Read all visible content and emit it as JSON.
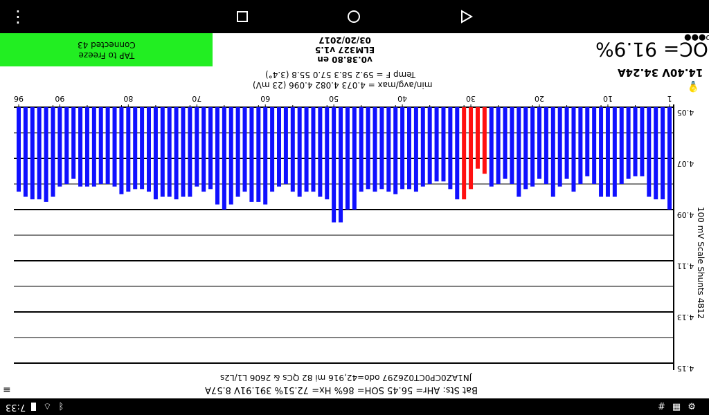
{
  "nav": {
    "menu": "⋮",
    "recents": "□",
    "home": "○",
    "back": "◁"
  },
  "header": {
    "freeze_line1": "TAP to Freeze",
    "freeze_line2": "Connected 43",
    "version_line1": "v0.38.80 en",
    "version_line2": "ELM327 v1.5",
    "version_line3": "03/20/2017",
    "soc": "SOC= 91.9%",
    "signal": "o●●●"
  },
  "pack": {
    "voltage_current": "14.40V 34.24A",
    "minavgmax": "min/avg/max = 4.073 4.082 4.096  (23 mV)",
    "temp": "Temp F = 59.2  58.3  57.0  55.8  (3.4°)",
    "scale_label": "100 mV Scale   Shunts 4812"
  },
  "chart_data": {
    "type": "bar",
    "title": "",
    "y_tick_labels": [
      "4.05",
      "4.07",
      "4.09",
      "4.11",
      "4.13",
      "4.15"
    ],
    "ylim": [
      4.05,
      4.15
    ],
    "x_tick_labels": [
      "1",
      "10",
      "20",
      "30",
      "40",
      "50",
      "60",
      "70",
      "80",
      "90",
      "96"
    ],
    "cell_numbers": [
      1,
      2,
      3,
      4,
      5,
      6,
      7,
      8,
      9,
      10,
      11,
      12,
      13,
      14,
      15,
      16,
      17,
      18,
      19,
      20,
      21,
      22,
      23,
      24,
      25,
      26,
      27,
      28,
      29,
      30,
      31,
      32,
      33,
      34,
      35,
      36,
      37,
      38,
      39,
      40,
      41,
      42,
      43,
      44,
      45,
      46,
      47,
      48,
      49,
      50,
      51,
      52,
      53,
      54,
      55,
      56,
      57,
      58,
      59,
      60,
      61,
      62,
      63,
      64,
      65,
      66,
      67,
      68,
      69,
      70,
      71,
      72,
      73,
      74,
      75,
      76,
      77,
      78,
      79,
      80,
      81,
      82,
      83,
      84,
      85,
      86,
      87,
      88,
      89,
      90,
      91,
      92,
      93,
      94,
      95,
      96
    ],
    "values": [
      4.09,
      4.086,
      4.086,
      4.085,
      4.077,
      4.077,
      4.078,
      4.08,
      4.085,
      4.085,
      4.085,
      4.08,
      4.077,
      4.08,
      4.083,
      4.078,
      4.081,
      4.085,
      4.08,
      4.078,
      4.081,
      4.082,
      4.085,
      4.08,
      4.078,
      4.08,
      4.081,
      4.076,
      4.074,
      4.082,
      4.086,
      4.086,
      4.082,
      4.079,
      4.079,
      4.08,
      4.081,
      4.083,
      4.082,
      4.082,
      4.084,
      4.083,
      4.082,
      4.083,
      4.082,
      4.083,
      4.09,
      4.09,
      4.095,
      4.095,
      4.086,
      4.085,
      4.083,
      4.083,
      4.085,
      4.083,
      4.08,
      4.081,
      4.083,
      4.088,
      4.087,
      4.087,
      4.083,
      4.085,
      4.088,
      4.09,
      4.088,
      4.082,
      4.083,
      4.081,
      4.085,
      4.085,
      4.086,
      4.085,
      4.085,
      4.086,
      4.083,
      4.082,
      4.082,
      4.083,
      4.084,
      4.081,
      4.08,
      4.08,
      4.081,
      4.081,
      4.081,
      4.078,
      4.08,
      4.081,
      4.085,
      4.087,
      4.086,
      4.086,
      4.085,
      4.083
    ],
    "highlighted_cells": [
      28,
      29,
      30,
      31
    ],
    "colors": {
      "normal": "#1010ff",
      "highlight": "#ff1010",
      "bg": "#ffffff"
    },
    "grid": true,
    "display": "upside-down (rotated 180°)"
  },
  "footer": {
    "vin_line": "JN1AZ0CP0CT026297 odo=42,916 mi  82 QCs & 2606 L1/L2s",
    "bat_line": "Bat Sts:  AHr= 56.45   SOH= 86%    Hx= 72.51%    391.91V 8.57A",
    "menu": "≡"
  },
  "status": {
    "time": "7:33",
    "left_icons": [
      "settings-gear-icon",
      "device-icon",
      "hash-icon"
    ]
  },
  "colors": {
    "freeze_button": "#22ee22",
    "bars": "#1010ff",
    "highlight": "#ff1010"
  }
}
